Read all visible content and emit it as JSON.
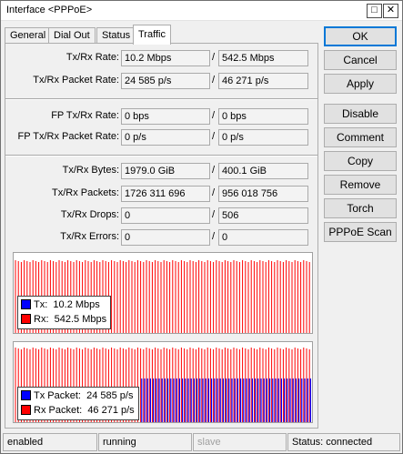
{
  "window": {
    "title": "Interface <PPPoE>",
    "maximize_glyph": "□",
    "close_glyph": "✕"
  },
  "tabs": [
    {
      "label": "General",
      "active": false
    },
    {
      "label": "Dial Out",
      "active": false
    },
    {
      "label": "Status",
      "active": false
    },
    {
      "label": "Traffic",
      "active": true
    }
  ],
  "stats": {
    "tx_rx_rate": {
      "label": "Tx/Rx Rate:",
      "tx": "10.2 Mbps",
      "rx": "542.5 Mbps"
    },
    "tx_rx_packet_rate": {
      "label": "Tx/Rx Packet Rate:",
      "tx": "24 585 p/s",
      "rx": "46 271 p/s"
    },
    "fp_tx_rx_rate": {
      "label": "FP Tx/Rx Rate:",
      "tx": "0 bps",
      "rx": "0 bps"
    },
    "fp_tx_rx_packet_rate": {
      "label": "FP Tx/Rx Packet Rate:",
      "tx": "0 p/s",
      "rx": "0 p/s"
    },
    "tx_rx_bytes": {
      "label": "Tx/Rx Bytes:",
      "tx": "1979.0 GiB",
      "rx": "400.1 GiB"
    },
    "tx_rx_packets": {
      "label": "Tx/Rx Packets:",
      "tx": "1726 311 696",
      "rx": "956 018 756"
    },
    "tx_rx_drops": {
      "label": "Tx/Rx Drops:",
      "tx": "0",
      "rx": "506"
    },
    "tx_rx_errors": {
      "label": "Tx/Rx Errors:",
      "tx": "0",
      "rx": "0"
    },
    "separator": "/"
  },
  "graphs": {
    "rate": {
      "legend": [
        {
          "label": "Tx:",
          "value": "10.2 Mbps",
          "color": "#0000ff"
        },
        {
          "label": "Rx:",
          "value": "542.5 Mbps",
          "color": "#ff0000"
        }
      ]
    },
    "packets": {
      "legend": [
        {
          "label": "Tx Packet:",
          "value": "24 585 p/s",
          "color": "#0000ff"
        },
        {
          "label": "Rx Packet:",
          "value": "46 271 p/s",
          "color": "#ff0000"
        }
      ]
    }
  },
  "buttons": [
    "OK",
    "Cancel",
    "Apply",
    "Disable",
    "Comment",
    "Copy",
    "Remove",
    "Torch",
    "PPPoE Scan"
  ],
  "statusbar": {
    "state": "enabled",
    "running": "running",
    "slave": "slave",
    "status": "Status: connected"
  },
  "colors": {
    "tx": "#0000ff",
    "rx": "#ff0000",
    "window_bg": "#f0f0f0",
    "default_button_border": "#0078d7"
  }
}
